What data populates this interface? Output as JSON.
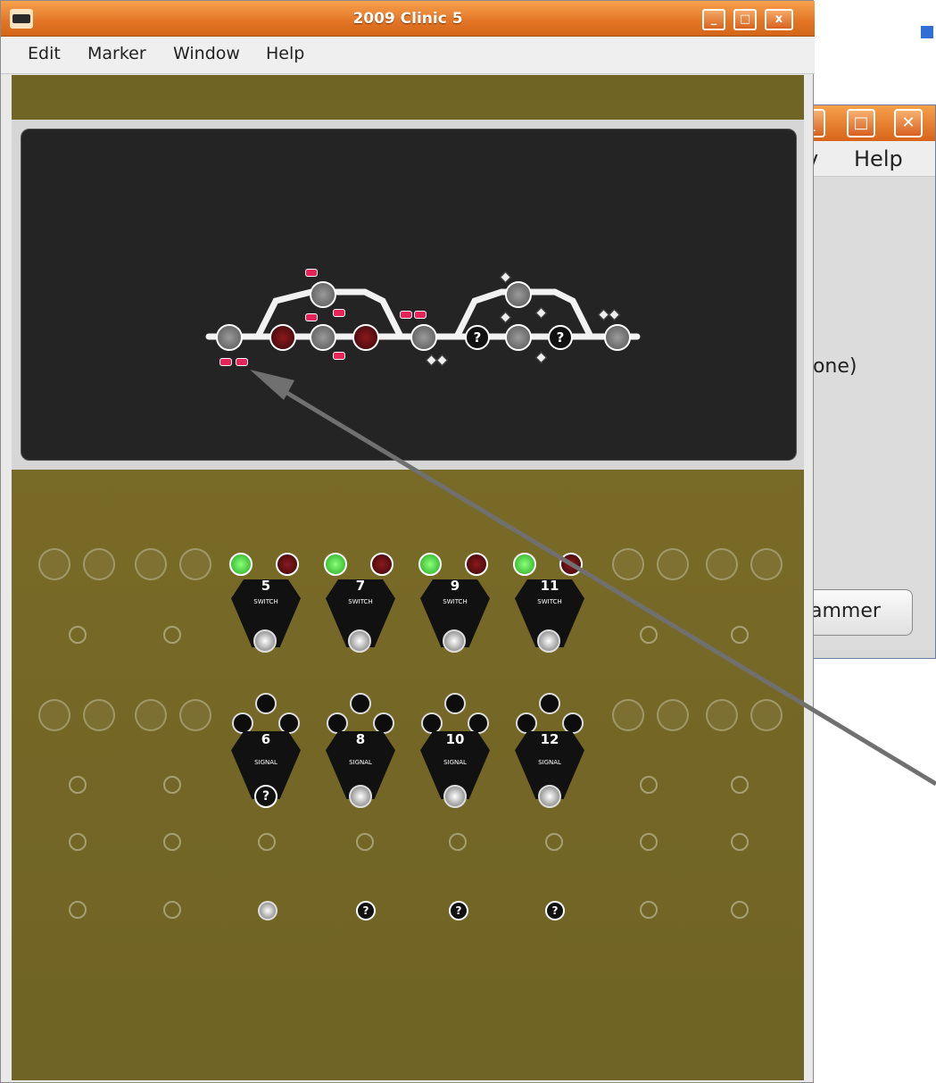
{
  "background_window": {
    "menu_help": "Help",
    "menu_partial": "v",
    "text_partial": "none)",
    "button_partial": "ammer"
  },
  "main_window": {
    "title": "2009 Clinic 5",
    "menu": [
      "Edit",
      "Marker",
      "Window",
      "Help"
    ],
    "titlebar_buttons": {
      "minimize": "_",
      "maximize": "□",
      "close": "x"
    }
  },
  "switch_plates": [
    {
      "number": "5",
      "label": "SWITCH"
    },
    {
      "number": "7",
      "label": "SWITCH"
    },
    {
      "number": "9",
      "label": "SWITCH"
    },
    {
      "number": "11",
      "label": "SWITCH"
    }
  ],
  "signal_plates": [
    {
      "number": "6",
      "label": "SIGNAL"
    },
    {
      "number": "8",
      "label": "SIGNAL"
    },
    {
      "number": "10",
      "label": "SIGNAL"
    },
    {
      "number": "12",
      "label": "SIGNAL"
    }
  ],
  "unknown_marker": "?",
  "colors": {
    "accent_titlebar": "#e27424",
    "panel": "#75682a",
    "track": "#242424",
    "stop": "#e8235a",
    "green_lamp": "#35e03a",
    "red_lamp": "#6a0d12"
  }
}
